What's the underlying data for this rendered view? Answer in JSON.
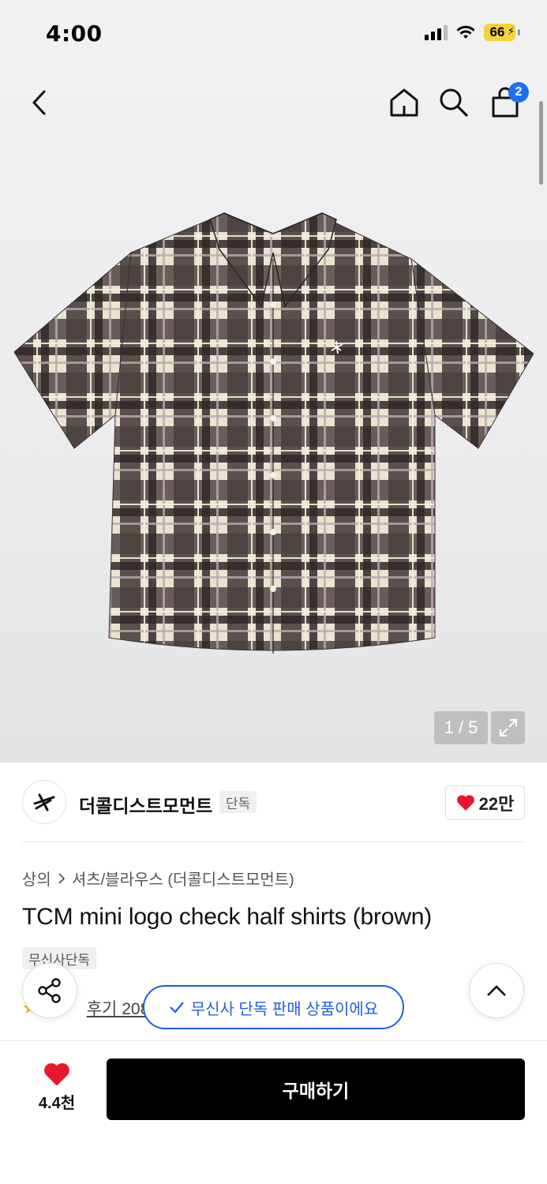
{
  "status_bar": {
    "time": "4:00",
    "battery": "66",
    "icons": [
      "signal-icon",
      "wifi-icon",
      "battery-charging-icon"
    ]
  },
  "nav": {
    "icons": [
      "back-icon",
      "home-icon",
      "search-icon",
      "cart-icon"
    ],
    "cart_badge": "2"
  },
  "gallery": {
    "counter": "1 / 5",
    "expand_icon": "expand-icon"
  },
  "brand": {
    "name": "더콜디스트모먼트",
    "tag": "단독",
    "likes": "22만",
    "logo_icon": "star-logo-icon"
  },
  "breadcrumb": {
    "category": "상의",
    "subcategory": "셔츠/블라우스 (더콜디스트모먼트)"
  },
  "product": {
    "title": "TCM mini logo check half shirts (brown)",
    "exclusive_tag": "무신사단독"
  },
  "rating": {
    "review_text": "후기 208"
  },
  "toast": {
    "message": "무신사 단독 판매 상품이에요"
  },
  "bottom": {
    "wish_count": "4.4천",
    "buy_label": "구매하기"
  },
  "colors": {
    "accent_blue": "#1e5fe8",
    "heart_red": "#e8182c",
    "badge_blue": "#1e6ff5"
  }
}
